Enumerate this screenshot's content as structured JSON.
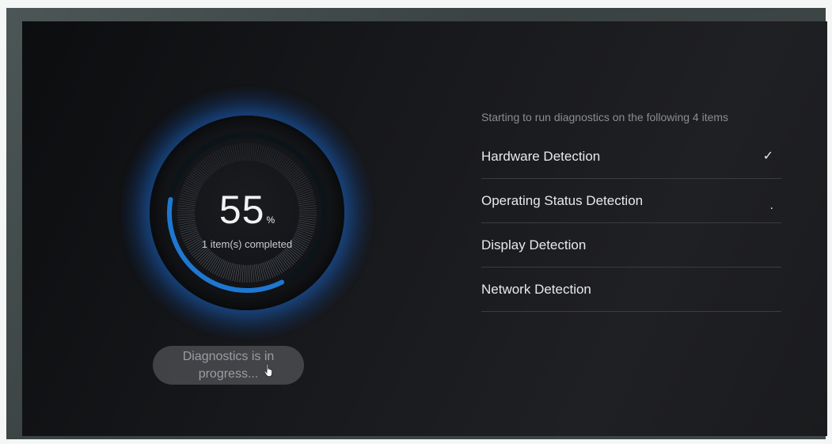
{
  "dial": {
    "percent": "55",
    "percent_sign": "%",
    "progress_fraction": 0.55,
    "completed_label": "1 item(s) completed",
    "accent_color": "#1e78d2"
  },
  "status": {
    "label": "Diagnostics is in progress..."
  },
  "diagnostics": {
    "intro": "Starting to run diagnostics on the following 4 items",
    "items": [
      {
        "label": "Hardware Detection",
        "state": "done",
        "mark": "✓"
      },
      {
        "label": "Operating Status Detection",
        "state": "running",
        "mark": "."
      },
      {
        "label": "Display Detection",
        "state": "pending",
        "mark": ""
      },
      {
        "label": "Network Detection",
        "state": "pending",
        "mark": ""
      }
    ]
  }
}
